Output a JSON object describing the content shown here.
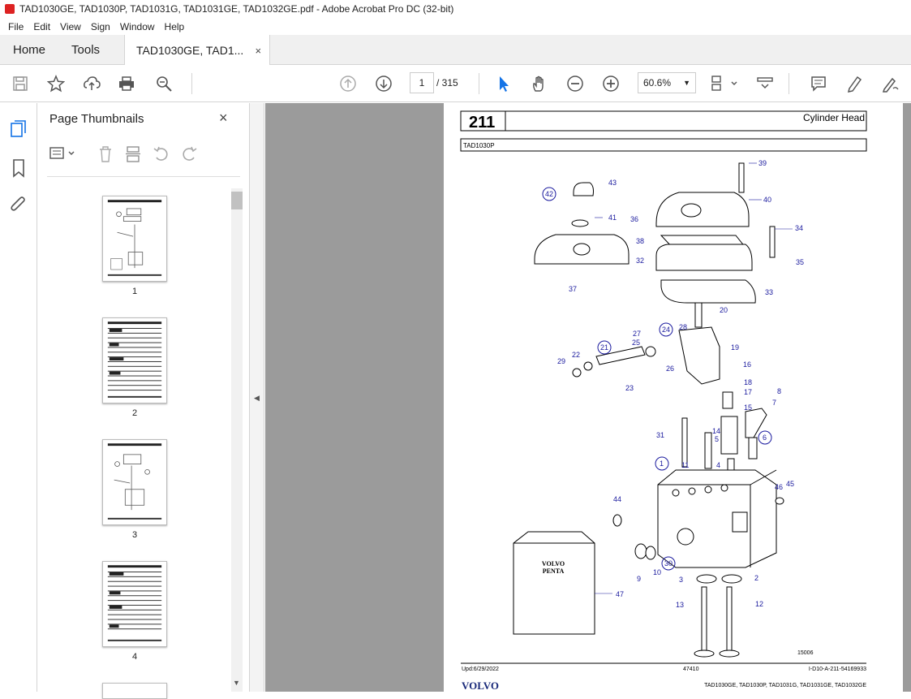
{
  "window": {
    "title": "TAD1030GE, TAD1030P, TAD1031G, TAD1031GE, TAD1032GE.pdf - Adobe Acrobat Pro DC (32-bit)"
  },
  "menu": [
    "File",
    "Edit",
    "View",
    "Sign",
    "Window",
    "Help"
  ],
  "tabs": {
    "home": "Home",
    "tools": "Tools",
    "document": "TAD1030GE, TAD1...",
    "close": "×"
  },
  "toolbar": {
    "page_current": "1",
    "page_total": "/ 315",
    "zoom": "60.6%"
  },
  "sidebar": {
    "title": "Page Thumbnails",
    "close": "×",
    "thumbnails": [
      {
        "label": "1"
      },
      {
        "label": "2"
      },
      {
        "label": "3"
      },
      {
        "label": "4"
      }
    ]
  },
  "document_page": {
    "section_number": "211",
    "section_title": "Cylinder Head",
    "model": "TAD1030P",
    "brand_box": "VOLVO\nPENTA",
    "brand_line1": "VOLVO",
    "brand_line2": "PENTA",
    "figure_id": "15006",
    "updated": "Upd:6/29/2022",
    "ref": "47410",
    "code": "I-D10-A-211-54169933",
    "footer_models": "TAD1030GE, TAD1030P, TAD1031G, TAD1031GE, TAD1032GE",
    "footer_logo": "VOLVO",
    "callouts": [
      "39",
      "40",
      "43",
      "42",
      "41",
      "36",
      "34",
      "38",
      "32",
      "35",
      "37",
      "33",
      "20",
      "27",
      "24",
      "28",
      "19",
      "21",
      "25",
      "22",
      "29",
      "26",
      "16",
      "23",
      "18",
      "17",
      "8",
      "15",
      "7",
      "14",
      "31",
      "5",
      "6",
      "11",
      "4",
      "1",
      "46",
      "45",
      "44",
      "30",
      "9",
      "10",
      "3",
      "2",
      "47",
      "13",
      "12"
    ]
  },
  "colors": {
    "accent": "#1473e6",
    "callout_text": "#1a1a9e",
    "viewer_bg": "#9b9b9b"
  }
}
